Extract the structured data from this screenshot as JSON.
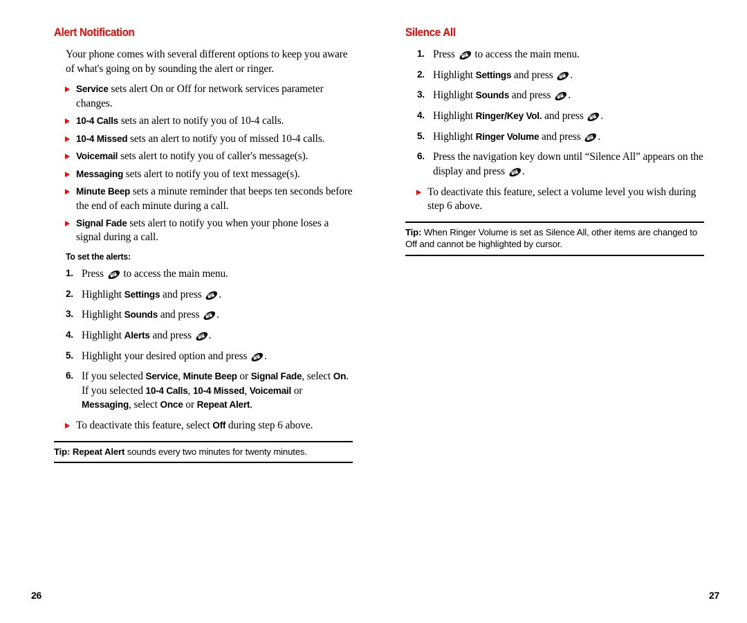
{
  "document": {
    "left_page_number": "26",
    "right_page_number": "27",
    "accent_color": "#ff0000",
    "icon_name": "ok-key-icon"
  },
  "left_column": {
    "title": "Alert Notification",
    "intro": "Your phone comes with several different options to keep you aware of what's going on by sounding the alert or ringer.",
    "bullets": [
      {
        "term": "Service",
        "rest": " sets alert On or Off for network services parameter changes."
      },
      {
        "term": "10-4 Calls",
        "rest": " sets an alert to notify you of 10-4 calls."
      },
      {
        "term": "10-4 Missed",
        "rest": " sets an alert to notify you of missed 10-4 calls."
      },
      {
        "term": "Voicemail",
        "rest": " sets alert to notify you of caller's message(s)."
      },
      {
        "term": "Messaging",
        "rest": " sets alert to notify you of text message(s)."
      },
      {
        "term": "Minute Beep",
        "rest": " sets a minute reminder that beeps ten seconds before the end of each minute during a call."
      },
      {
        "term": "Signal Fade",
        "rest": " sets alert to notify you when your phone loses a signal during a call."
      }
    ],
    "subhead": "To set the alerts:",
    "steps": [
      {
        "num": "1.",
        "pre": "Press ",
        "icon": true,
        "post": " to access the main menu."
      },
      {
        "num": "2.",
        "pre": "Highlight ",
        "term": "Settings",
        "mid": " and press ",
        "icon": true,
        "post": "."
      },
      {
        "num": "3.",
        "pre": "Highlight ",
        "term": "Sounds",
        "mid": " and press ",
        "icon": true,
        "post": "."
      },
      {
        "num": "4.",
        "pre": "Highlight ",
        "term": "Alerts",
        "mid": " and press ",
        "icon": true,
        "post": "."
      },
      {
        "num": "5.",
        "pre": "Highlight your desired option and press ",
        "icon": true,
        "post": "."
      }
    ],
    "step6": {
      "num": "6.",
      "line1_pre": "If you selected ",
      "line1_t1": "Service",
      "line1_s1": ", ",
      "line1_t2": "Minute Beep",
      "line1_s2": " or ",
      "line1_t3": "Signal Fade",
      "line1_s3": ", select ",
      "line1_t4": "On",
      "line1_end": ".",
      "line2_pre": "If you selected ",
      "line2_t1": "10-4 Calls",
      "line2_s1": ", ",
      "line2_t2": "10-4 Missed",
      "line2_s2": ", ",
      "line2_t3": "Voicemail",
      "line2_s3": " or ",
      "line2_t4": "Messaging",
      "line2_end": ",",
      "line3_pre": "select ",
      "line3_t1": "Once",
      "line3_s1": " or ",
      "line3_t2": "Repeat Alert",
      "line3_end": "."
    },
    "deactivate_bullet": {
      "pre": "To deactivate this feature, select ",
      "term": "Off",
      "post": " during step 6 above."
    },
    "tip": {
      "label": "Tip: ",
      "term": "Repeat Alert",
      "rest": " sounds every two minutes for twenty minutes."
    }
  },
  "right_column": {
    "title": "Silence All",
    "steps": [
      {
        "num": "1.",
        "pre": "Press ",
        "icon": true,
        "post": " to access the main menu."
      },
      {
        "num": "2.",
        "pre": "Highlight ",
        "term": "Settings",
        "mid": " and press ",
        "icon": true,
        "post": "."
      },
      {
        "num": "3.",
        "pre": "Highlight ",
        "term": "Sounds",
        "mid": " and press ",
        "icon": true,
        "post": "."
      },
      {
        "num": "4.",
        "pre": "Highlight ",
        "term": "Ringer/Key Vol.",
        "mid": " and press ",
        "icon": true,
        "post": "."
      },
      {
        "num": "5.",
        "pre": "Highlight ",
        "term": "Ringer Volume",
        "mid": " and press ",
        "icon": true,
        "post": "."
      },
      {
        "num": "6.",
        "pre": "Press the navigation key down until “Silence All” appears on the display and press ",
        "icon": true,
        "post": "."
      }
    ],
    "deactivate_bullet": {
      "pre": "To deactivate this feature, select a volume level you wish during step 6 above.",
      "term": "",
      "post": ""
    },
    "tip": {
      "label": "Tip: ",
      "term": "",
      "rest": "When Ringer Volume is set as Silence All, other items are changed to Off and cannot be highlighted by cursor."
    }
  }
}
